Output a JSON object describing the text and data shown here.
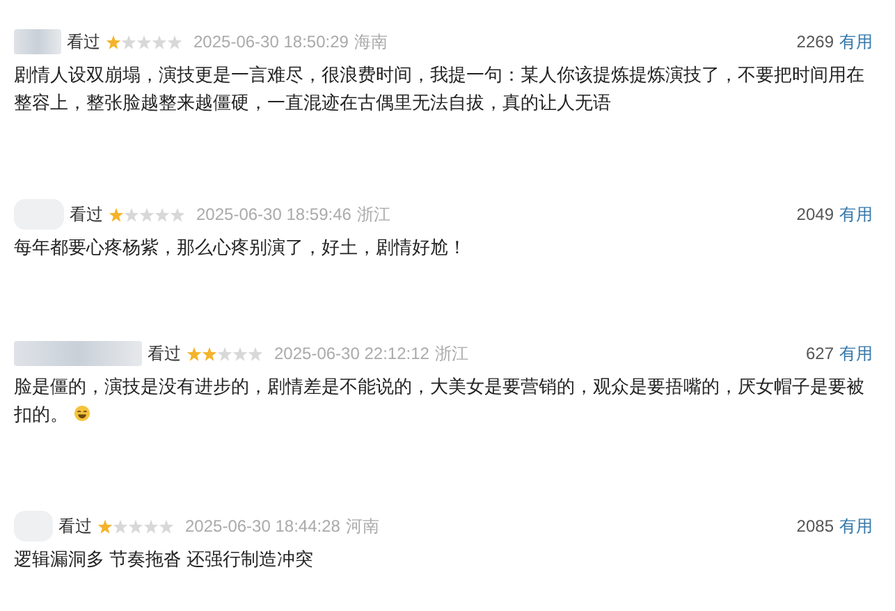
{
  "reviews": [
    {
      "status": "看过",
      "stars": 1,
      "time": "2025-06-30 18:50:29",
      "region": "海南",
      "votes": "2269",
      "vote_label": "有用",
      "text": "剧情人设双崩塌，演技更是一言难尽，很浪费时间，我提一句：某人你该提炼提炼演技了，不要把时间用在整容上，整张脸越整来越僵硬，一直混迹在古偶里无法自拔，真的让人无语",
      "emoji": false
    },
    {
      "status": "看过",
      "stars": 1,
      "time": "2025-06-30 18:59:46",
      "region": "浙江",
      "votes": "2049",
      "vote_label": "有用",
      "text": "每年都要心疼杨紫，那么心疼别演了，好土，剧情好尬！",
      "emoji": false
    },
    {
      "status": "看过",
      "stars": 2,
      "time": "2025-06-30 22:12:12",
      "region": "浙江",
      "votes": "627",
      "vote_label": "有用",
      "text": "脸是僵的，演技是没有进步的，剧情差是不能说的，大美女是要营销的，观众是要捂嘴的，厌女帽子是要被扣的。",
      "emoji": true
    },
    {
      "status": "看过",
      "stars": 1,
      "time": "2025-06-30 18:44:28",
      "region": "河南",
      "votes": "2085",
      "vote_label": "有用",
      "text": "逻辑漏洞多 节奏拖沓 还强行制造冲突",
      "emoji": false
    }
  ]
}
